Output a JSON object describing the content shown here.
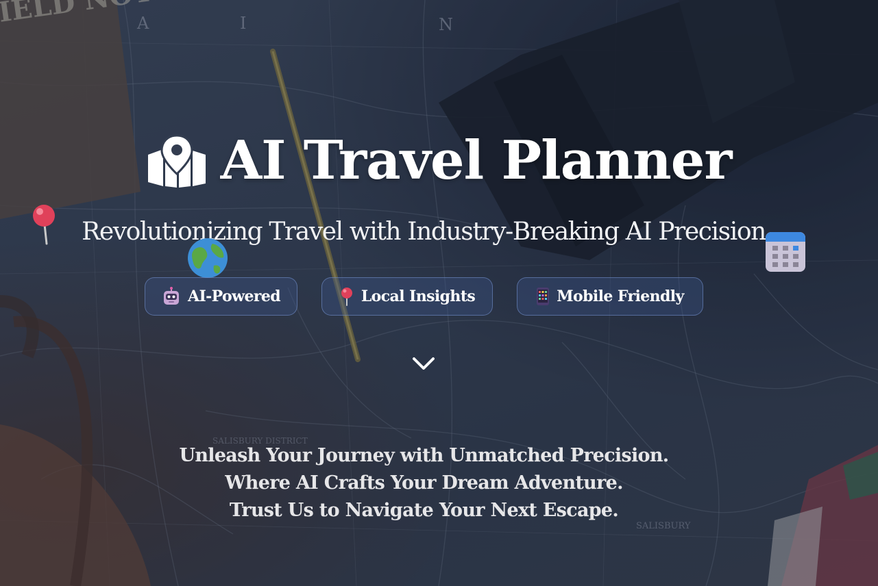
{
  "hero": {
    "title": "AI Travel Planner",
    "subtitle": "Revolutionizing Travel with Industry-Breaking AI Precision",
    "title_icon": "map-location-icon"
  },
  "features": [
    {
      "label": "AI-Powered",
      "icon": "robot-icon"
    },
    {
      "label": "Local Insights",
      "icon": "pin-icon"
    },
    {
      "label": "Mobile Friendly",
      "icon": "mobile-phone-icon"
    }
  ],
  "floating_icons": [
    "pushpin-icon",
    "globe-icon",
    "calendar-icon"
  ],
  "scroll_indicator": "chevron-down-icon",
  "tagline": {
    "line1": "Unleash Your Journey with Unmatched Precision.",
    "line2": "Where AI Crafts Your Dream Adventure.",
    "line3": "Trust Us to Navigate Your Next Escape."
  },
  "background": {
    "notebook_text": "IELD NOTES",
    "map_letters": [
      "A",
      "I",
      "N"
    ],
    "map_labels": [
      "SALISBURY",
      "SALISBURY DISTRICT"
    ]
  },
  "colors": {
    "text": "#ffffff",
    "pill_border": "#7896d2",
    "pill_fill": "#3c558c"
  }
}
